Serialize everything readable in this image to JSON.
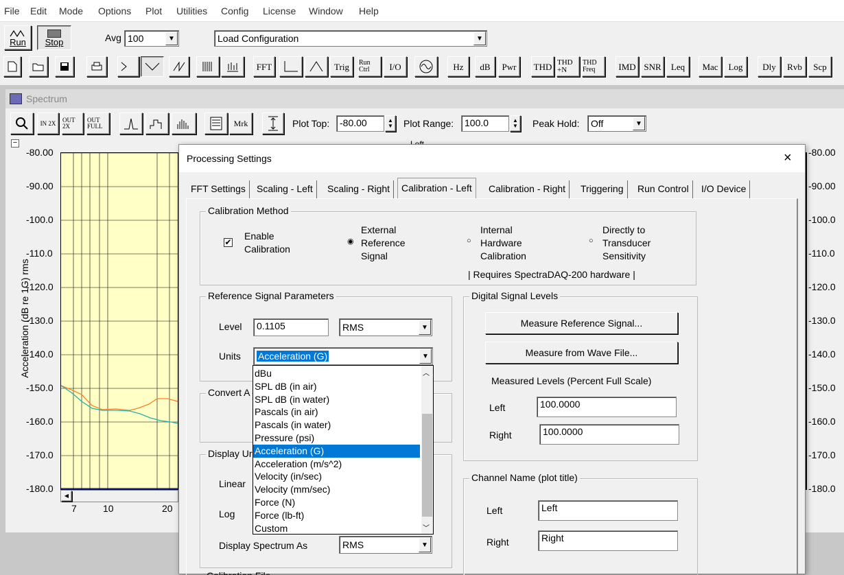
{
  "menu": [
    "File",
    "Edit",
    "Mode",
    "Options",
    "Plot",
    "Utilities",
    "Config",
    "License",
    "Window",
    "Help"
  ],
  "toolbar1": {
    "run_label": "Run",
    "stop_label": "Stop",
    "avg_label": "Avg",
    "avg_value": "100",
    "config_value": "Load Configuration"
  },
  "toolbar2": {
    "buttons": [
      "FFT",
      "Trig",
      "Run Ctrl",
      "I/O",
      "Hz",
      "dB",
      "Pwr",
      "THD",
      "THD +N",
      "THD Freq",
      "IMD",
      "SNR",
      "Leq",
      "Mac",
      "Log",
      "Dly",
      "Rvb",
      "Scp"
    ]
  },
  "spectrum": {
    "title": "Spectrum",
    "mrk_label": "Mrk",
    "zoom_in": "IN 2X",
    "zoom_out": "OUT 2X",
    "zoom_full": "OUT FULL",
    "plot_top_label": "Plot Top:",
    "plot_top_value": "-80.00",
    "plot_range_label": "Plot Range:",
    "plot_range_value": "100.0",
    "peak_hold_label": "Peak Hold:",
    "peak_hold_value": "Off",
    "collapse": "−",
    "top_fragment": "Left",
    "y_axis_label": "Acceleration (dB re 1G) rms",
    "y_ticks": [
      "-80.00",
      "-90.00",
      "-100.0",
      "-110.0",
      "-120.0",
      "-130.0",
      "-140.0",
      "-150.0",
      "-160.0",
      "-170.0",
      "-180.0"
    ],
    "y_ticks_right": [
      "-80.00",
      "-90.00",
      "-100.0",
      "-110.0",
      "-120.0",
      "-130.0",
      "-140.0",
      "-150.0",
      "-160.0",
      "-170.0",
      "-180.0"
    ],
    "x_ticks": [
      "7",
      "10",
      "20"
    ],
    "colors": {
      "plot_bg": "#ffffc6",
      "left_trace": "#ff7f27",
      "right_trace": "#20b2aa"
    }
  },
  "dialog": {
    "title": "Processing Settings",
    "close_icon": "×",
    "tabs": [
      "FFT Settings",
      "Scaling - Left",
      "Scaling - Right",
      "Calibration - Left",
      "Calibration - Right",
      "Triggering",
      "Run Control",
      "I/O Device"
    ],
    "active_tab": "Calibration - Left",
    "calibration_method": {
      "legend": "Calibration Method",
      "enable_label": "Enable Calibration",
      "enable_checked": true,
      "opt_external": "External Reference Signal",
      "opt_internal": "Internal Hardware Calibration",
      "opt_direct": "Directly to Transducer Sensitivity",
      "note": "|  Requires SpectraDAQ-200 hardware  |"
    },
    "ref_params": {
      "legend": "Reference Signal Parameters",
      "level_label": "Level",
      "level_value": "0.1105",
      "level_unit": "RMS",
      "units_label": "Units",
      "units_value": "Acceleration (G)",
      "units_options": [
        "dBu",
        "SPL dB (in air)",
        "SPL dB (in water)",
        "Pascals (in air)",
        "Pascals (in water)",
        "Pressure (psi)",
        "Acceleration (G)",
        "Acceleration (m/s^2)",
        "Velocity (in/sec)",
        "Velocity (mm/sec)",
        "Force (N)",
        "Force (lb-ft)",
        "Custom"
      ],
      "selected_index": 6
    },
    "convert_legend_fragment": "Convert A",
    "display_units": {
      "legend_fragment": "Display Ur",
      "linear_label": "Linear",
      "log_label": "Log",
      "spectrum_as_label": "Display Spectrum As",
      "spectrum_as_value": "RMS"
    },
    "calibration_file_fragment": "Calibration File",
    "digital_levels": {
      "legend": "Digital Signal Levels",
      "measure_ref_btn": "Measure Reference Signal...",
      "measure_wave_btn": "Measure from Wave File...",
      "measured_label": "Measured Levels (Percent Full Scale)",
      "left_label": "Left",
      "left_value": "100.0000",
      "right_label": "Right",
      "right_value": "100.0000"
    },
    "channel_name": {
      "legend": "Channel Name (plot title)",
      "left_label": "Left",
      "left_value": "Left",
      "right_label": "Right",
      "right_value": "Right"
    }
  }
}
